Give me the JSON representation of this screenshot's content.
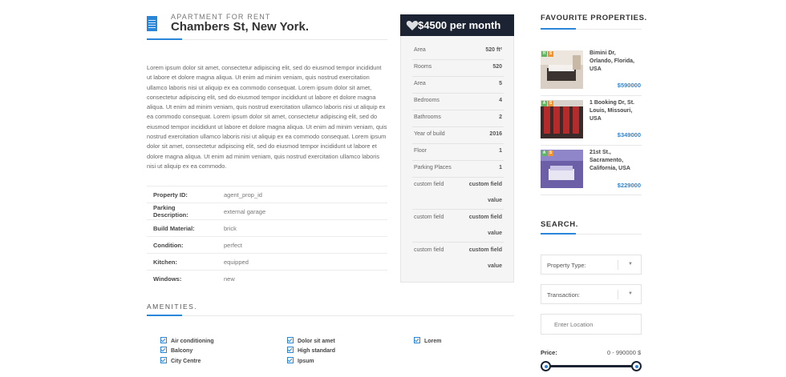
{
  "header": {
    "subtitle": "APARTMENT FOR RENT",
    "title": "Chambers St, New York."
  },
  "description": "Lorem ipsum dolor sit amet, consectetur adipiscing elit, sed do eiusmod tempor incididunt ut labore et dolore magna aliqua. Ut enim ad minim veniam, quis nostrud exercitation ullamco laboris nisi ut aliquip ex ea commodo consequat. Lorem ipsum dolor sit amet, consectetur adipiscing elit, sed do eiusmod tempor incididunt ut labore et dolore magna aliqua. Ut enim ad minim veniam, quis nostrud exercitation ullamco laboris nisi ut aliquip ex ea commodo consequat. Lorem ipsum dolor sit amet, consectetur adipiscing elit, sed do eiusmod tempor incididunt ut labore et dolore magna aliqua. Ut enim ad minim veniam, quis nostrud exercitation ullamco laboris nisi ut aliquip ex ea commodo consequat. Lorem ipsum dolor sit amet, consectetur adipiscing elit, sed do eiusmod tempor incididunt ut labore et dolore magna aliqua. Ut enim ad minim veniam, quis nostrud exercitation ullamco laboris nisi ut aliquip ex ea commodo.",
  "details": [
    {
      "label": "Property ID:",
      "value": "agent_prop_id"
    },
    {
      "label": "Parking Description:",
      "value": "external garage"
    },
    {
      "label": "Build Material:",
      "value": "brick"
    },
    {
      "label": "Condition:",
      "value": "perfect"
    },
    {
      "label": "Kitchen:",
      "value": "equipped"
    },
    {
      "label": "Windows:",
      "value": "new"
    }
  ],
  "price_box": {
    "price": "$4500 per month",
    "specs": [
      {
        "label": "Area",
        "value": "520 ft²"
      },
      {
        "label": "Rooms",
        "value": "520"
      },
      {
        "label": "Area",
        "value": "5"
      },
      {
        "label": "Bedrooms",
        "value": "4"
      },
      {
        "label": "Bathrooms",
        "value": "2"
      },
      {
        "label": "Year of build",
        "value": "2016"
      },
      {
        "label": "Floor",
        "value": "1"
      },
      {
        "label": "Parking Places",
        "value": "1"
      },
      {
        "label": "custom field",
        "value": "custom field",
        "value2": "value"
      },
      {
        "label": "custom field",
        "value": "custom field",
        "value2": "value"
      },
      {
        "label": "custom field",
        "value": "custom field",
        "value2": "value"
      }
    ]
  },
  "amenities": {
    "title": "AMENITIES.",
    "items": [
      "Air conditioning",
      "Balcony",
      "City Centre",
      "Dolor sit amet",
      "High standard",
      "Ipsum",
      "Lorem"
    ]
  },
  "sidebar": {
    "favourites_title": "FAVOURITE PROPERTIES.",
    "favourites": [
      {
        "badges": [
          "H",
          "S"
        ],
        "address": "Bimini Dr, Orlando, Florida, USA",
        "price": "$590000"
      },
      {
        "badges": [
          "A",
          "S"
        ],
        "address": "1 Booking Dr, St. Louis, Missouri, USA",
        "price": "$349000"
      },
      {
        "badges": [
          "A",
          "S"
        ],
        "address": "21st St., Sacramento, California, USA",
        "price": "$229000"
      }
    ],
    "search_title": "SEARCH.",
    "property_type_label": "Property Type:",
    "transaction_label": "Transaction:",
    "location_placeholder": "Enter Location",
    "price_label": "Price:",
    "price_range": "0 - 990000 $"
  },
  "colors": {
    "accent": "#2a86d8",
    "dark": "#1c2433",
    "badge_green": "#5cb85c",
    "badge_orange": "#f0932b"
  }
}
